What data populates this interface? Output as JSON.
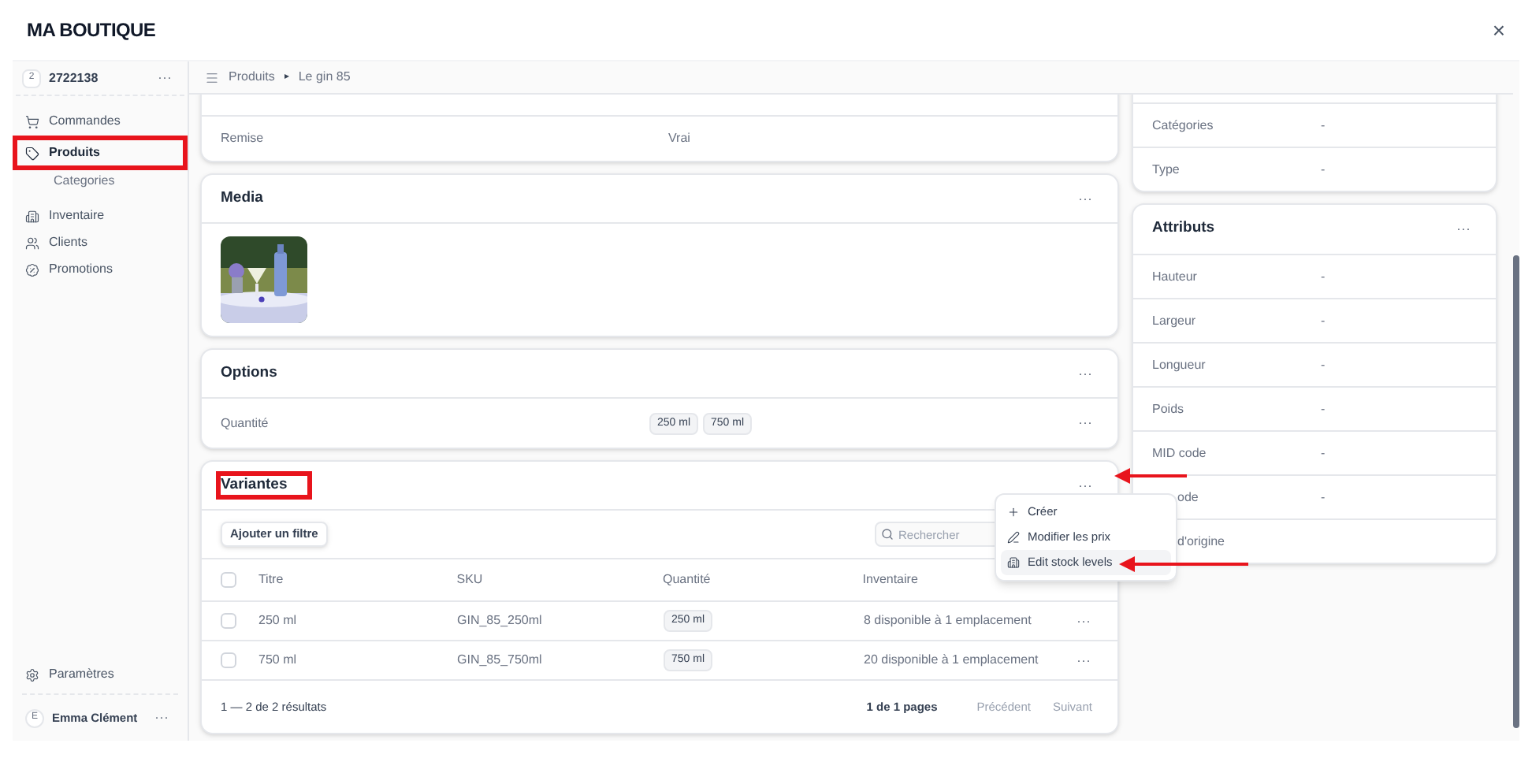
{
  "app": {
    "title": "MA BOUTIQUE",
    "close": "×"
  },
  "store": {
    "badge": "2",
    "name": "2722138",
    "more": "···"
  },
  "nav": [
    {
      "label": "Commandes",
      "selected": false
    },
    {
      "label": "Produits",
      "selected": true,
      "children": [
        {
          "label": "Categories",
          "selected": false
        }
      ]
    },
    {
      "label": "Inventaire",
      "selected": false
    },
    {
      "label": "Clients",
      "selected": false
    },
    {
      "label": "Promotions",
      "selected": false
    }
  ],
  "settings": {
    "label": "Paramètres"
  },
  "user": {
    "initial": "E",
    "name": "Emma Clément",
    "more": "···"
  },
  "breadcrumb": {
    "items": [
      "Produits",
      "Le gin 85"
    ],
    "separator": "▸"
  },
  "general_card": {
    "rows": [
      {
        "label": "Remise",
        "value": "Vrai"
      }
    ]
  },
  "media_card": {
    "title": "Media",
    "more": "···"
  },
  "options_card": {
    "title": "Options",
    "more": "···",
    "rows": [
      {
        "label": "Quantité",
        "values": [
          "250 ml",
          "750 ml"
        ],
        "more": "···"
      }
    ]
  },
  "variants_card": {
    "title": "Variantes",
    "more": "···",
    "filter_button": "Ajouter un filtre",
    "search": {
      "placeholder": "Rechercher"
    },
    "select_all": {
      "checked": false
    },
    "columns": [
      "Titre",
      "SKU",
      "Quantité",
      "Inventaire"
    ],
    "rows": [
      {
        "checked": false,
        "title": "250 ml",
        "sku": "GIN_85_250ml",
        "quantity": "250 ml",
        "inventory": "8 disponible à 1 emplacement",
        "more": "···"
      },
      {
        "checked": false,
        "title": "750 ml",
        "sku": "GIN_85_750ml",
        "quantity": "750 ml",
        "inventory": "20 disponible à 1 emplacement",
        "more": "···"
      }
    ],
    "results": "1 — 2 de 2 résultats",
    "pages": "1 de 1 pages",
    "pager": [
      {
        "label": "Précédent",
        "disabled": true
      },
      {
        "label": "Suivant",
        "disabled": true
      }
    ]
  },
  "menu": {
    "items": [
      {
        "label": "Créer",
        "selected": false
      },
      {
        "label": "Modifier les prix",
        "selected": false
      },
      {
        "label": "Edit stock levels",
        "selected": true
      }
    ]
  },
  "organize_card": {
    "rows": [
      {
        "label": "Catégories",
        "value": "-"
      },
      {
        "label": "Type",
        "value": "-"
      }
    ]
  },
  "attributes_card": {
    "title": "Attributs",
    "more": "···",
    "rows": [
      {
        "label": "Hauteur",
        "value": "-"
      },
      {
        "label": "Largeur",
        "value": "-"
      },
      {
        "label": "Longueur",
        "value": "-"
      },
      {
        "label": "Poids",
        "value": "-"
      },
      {
        "label": "MID code",
        "value": "-"
      },
      {
        "label": "ode",
        "value": "-",
        "covered": true
      },
      {
        "label": "d'origine",
        "covered": true
      }
    ]
  }
}
